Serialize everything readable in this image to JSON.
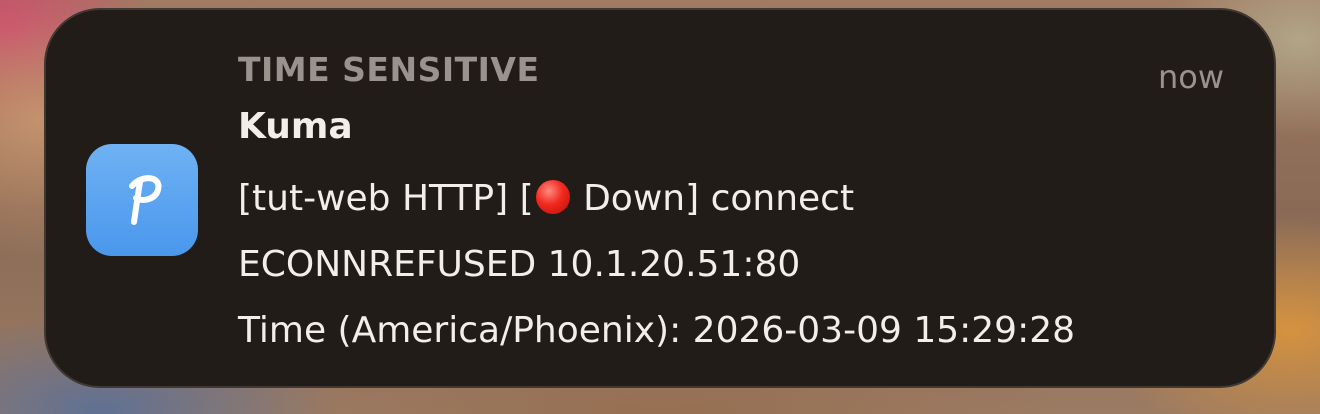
{
  "notification": {
    "header_label": "TIME SENSITIVE",
    "timestamp": "now",
    "app_name": "Kuma",
    "app_icon": "pushover-p-icon",
    "app_icon_color": "#4a97ec",
    "body": {
      "prefix": "[tut-web HTTP] [",
      "status_icon": "red-circle-icon",
      "status_text": " Down] connect",
      "line2": "ECONNREFUSED 10.1.20.51:80",
      "line3": "Time (America/Phoenix): 2026-03-09 15:29:28"
    }
  }
}
